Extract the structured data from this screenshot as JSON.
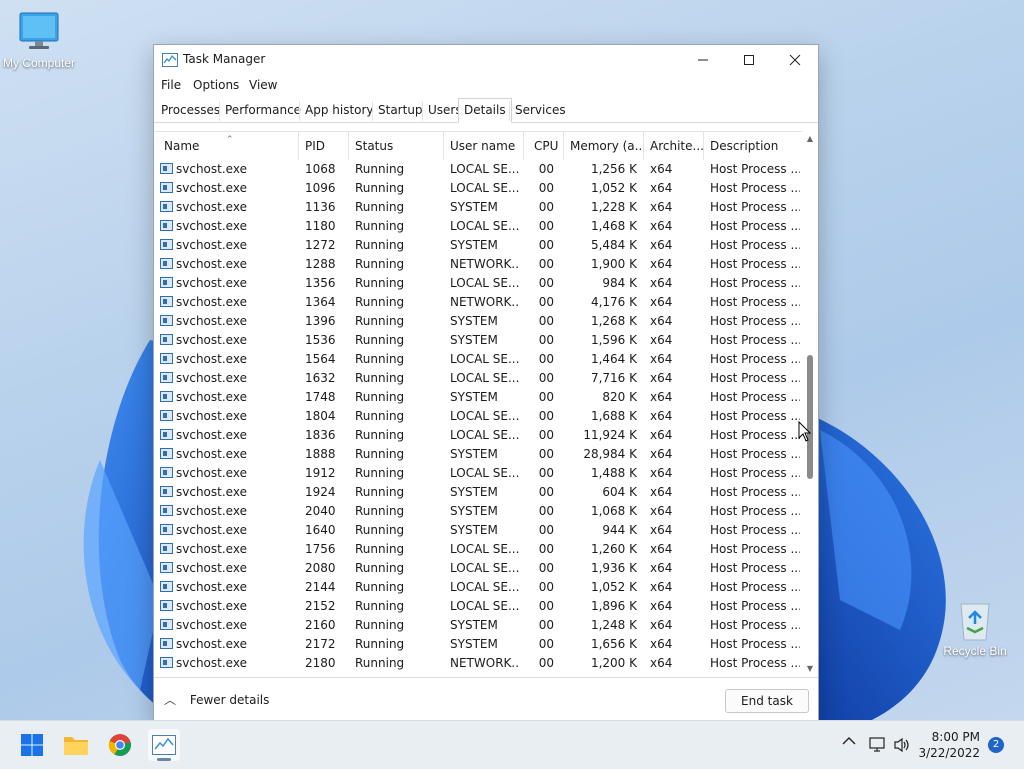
{
  "desktop": {
    "my_computer_label": "My Computer",
    "recycle_bin_label": "Recycle Bin"
  },
  "window": {
    "title": "Task Manager",
    "menu": [
      "File",
      "Options",
      "View"
    ],
    "tabs": [
      "Processes",
      "Performance",
      "App history",
      "Startup",
      "Users",
      "Details",
      "Services"
    ],
    "active_tab": "Details"
  },
  "table": {
    "columns": [
      "Name",
      "PID",
      "Status",
      "User name",
      "CPU",
      "Memory (a...",
      "Archite...",
      "Description"
    ],
    "rows": [
      [
        "svchost.exe",
        "1068",
        "Running",
        "LOCAL SE...",
        "00",
        "1,256 K",
        "x64",
        "Host Process ..."
      ],
      [
        "svchost.exe",
        "1096",
        "Running",
        "LOCAL SE...",
        "00",
        "1,052 K",
        "x64",
        "Host Process ..."
      ],
      [
        "svchost.exe",
        "1136",
        "Running",
        "SYSTEM",
        "00",
        "1,228 K",
        "x64",
        "Host Process ..."
      ],
      [
        "svchost.exe",
        "1180",
        "Running",
        "LOCAL SE...",
        "00",
        "1,468 K",
        "x64",
        "Host Process ..."
      ],
      [
        "svchost.exe",
        "1272",
        "Running",
        "SYSTEM",
        "00",
        "5,484 K",
        "x64",
        "Host Process ..."
      ],
      [
        "svchost.exe",
        "1288",
        "Running",
        "NETWORK...",
        "00",
        "1,900 K",
        "x64",
        "Host Process ..."
      ],
      [
        "svchost.exe",
        "1356",
        "Running",
        "LOCAL SE...",
        "00",
        "984 K",
        "x64",
        "Host Process ..."
      ],
      [
        "svchost.exe",
        "1364",
        "Running",
        "NETWORK...",
        "00",
        "4,176 K",
        "x64",
        "Host Process ..."
      ],
      [
        "svchost.exe",
        "1396",
        "Running",
        "SYSTEM",
        "00",
        "1,268 K",
        "x64",
        "Host Process ..."
      ],
      [
        "svchost.exe",
        "1536",
        "Running",
        "SYSTEM",
        "00",
        "1,596 K",
        "x64",
        "Host Process ..."
      ],
      [
        "svchost.exe",
        "1564",
        "Running",
        "LOCAL SE...",
        "00",
        "1,464 K",
        "x64",
        "Host Process ..."
      ],
      [
        "svchost.exe",
        "1632",
        "Running",
        "LOCAL SE...",
        "00",
        "7,716 K",
        "x64",
        "Host Process ..."
      ],
      [
        "svchost.exe",
        "1748",
        "Running",
        "SYSTEM",
        "00",
        "820 K",
        "x64",
        "Host Process ..."
      ],
      [
        "svchost.exe",
        "1804",
        "Running",
        "LOCAL SE...",
        "00",
        "1,688 K",
        "x64",
        "Host Process ..."
      ],
      [
        "svchost.exe",
        "1836",
        "Running",
        "LOCAL SE...",
        "00",
        "11,924 K",
        "x64",
        "Host Process ..."
      ],
      [
        "svchost.exe",
        "1888",
        "Running",
        "SYSTEM",
        "00",
        "28,984 K",
        "x64",
        "Host Process ..."
      ],
      [
        "svchost.exe",
        "1912",
        "Running",
        "LOCAL SE...",
        "00",
        "1,488 K",
        "x64",
        "Host Process ..."
      ],
      [
        "svchost.exe",
        "1924",
        "Running",
        "SYSTEM",
        "00",
        "604 K",
        "x64",
        "Host Process ..."
      ],
      [
        "svchost.exe",
        "2040",
        "Running",
        "SYSTEM",
        "00",
        "1,068 K",
        "x64",
        "Host Process ..."
      ],
      [
        "svchost.exe",
        "1640",
        "Running",
        "SYSTEM",
        "00",
        "944 K",
        "x64",
        "Host Process ..."
      ],
      [
        "svchost.exe",
        "1756",
        "Running",
        "LOCAL SE...",
        "00",
        "1,260 K",
        "x64",
        "Host Process ..."
      ],
      [
        "svchost.exe",
        "2080",
        "Running",
        "LOCAL SE...",
        "00",
        "1,936 K",
        "x64",
        "Host Process ..."
      ],
      [
        "svchost.exe",
        "2144",
        "Running",
        "LOCAL SE...",
        "00",
        "1,052 K",
        "x64",
        "Host Process ..."
      ],
      [
        "svchost.exe",
        "2152",
        "Running",
        "LOCAL SE...",
        "00",
        "1,896 K",
        "x64",
        "Host Process ..."
      ],
      [
        "svchost.exe",
        "2160",
        "Running",
        "SYSTEM",
        "00",
        "1,248 K",
        "x64",
        "Host Process ..."
      ],
      [
        "svchost.exe",
        "2172",
        "Running",
        "SYSTEM",
        "00",
        "1,656 K",
        "x64",
        "Host Process ..."
      ],
      [
        "svchost.exe",
        "2180",
        "Running",
        "NETWORK...",
        "00",
        "1,200 K",
        "x64",
        "Host Process ..."
      ]
    ]
  },
  "footer": {
    "fewer_details_label": "Fewer details",
    "end_task_label": "End task"
  },
  "taskbar": {
    "time": "8:00 PM",
    "date": "3/22/2022",
    "notification_count": "2"
  },
  "colors": {
    "accent": "#1f64c8",
    "icon_blue": "#2f6fb0"
  }
}
